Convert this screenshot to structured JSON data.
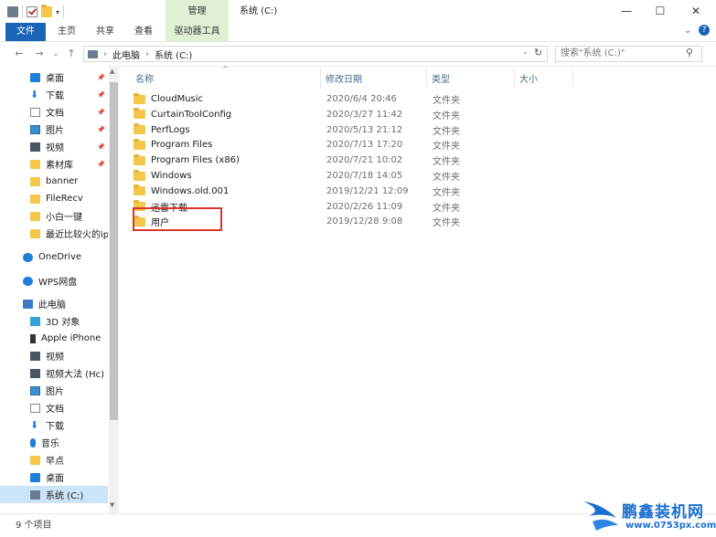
{
  "window": {
    "title": "系统 (C:)",
    "manage_tab": "管理",
    "min": "—",
    "max": "☐",
    "close": "✕"
  },
  "ribbon": {
    "tabs": [
      "文件",
      "主页",
      "共享",
      "查看",
      "驱动器工具"
    ]
  },
  "address": {
    "segments": [
      "此电脑",
      "系统 (C:)"
    ],
    "search_placeholder": "搜索\"系统 (C:)\""
  },
  "nav": {
    "items": [
      {
        "label": "桌面",
        "icon": "desktop-icon",
        "pinned": true
      },
      {
        "label": "下载",
        "icon": "download-icon",
        "pinned": true
      },
      {
        "label": "文档",
        "icon": "document-icon",
        "pinned": true
      },
      {
        "label": "图片",
        "icon": "picture-icon",
        "pinned": true
      },
      {
        "label": "视频",
        "icon": "video-icon",
        "pinned": true
      },
      {
        "label": "素材库",
        "icon": "folder-icon",
        "pinned": true
      },
      {
        "label": "banner",
        "icon": "folder-icon",
        "pinned": false
      },
      {
        "label": "FileRecv",
        "icon": "folder-icon",
        "pinned": false
      },
      {
        "label": "小白一键",
        "icon": "folder-icon",
        "pinned": false
      },
      {
        "label": "最近比较火的ipl",
        "icon": "folder-icon",
        "pinned": false
      },
      {
        "label": "OneDrive",
        "icon": "cloud-icon",
        "pinned": false
      },
      {
        "label": "WPS网盘",
        "icon": "cloud-icon",
        "pinned": false
      },
      {
        "label": "此电脑",
        "icon": "computer-icon",
        "pinned": false
      },
      {
        "label": "3D 对象",
        "icon": "cube-icon",
        "pinned": false
      },
      {
        "label": "Apple iPhone",
        "icon": "phone-icon",
        "pinned": false
      },
      {
        "label": "视频",
        "icon": "video-icon",
        "pinned": false
      },
      {
        "label": "视频大法 (Hc)",
        "icon": "video-icon",
        "pinned": false
      },
      {
        "label": "图片",
        "icon": "picture-icon",
        "pinned": false
      },
      {
        "label": "文档",
        "icon": "document-icon",
        "pinned": false
      },
      {
        "label": "下载",
        "icon": "download-icon",
        "pinned": false
      },
      {
        "label": "音乐",
        "icon": "music-icon",
        "pinned": false
      },
      {
        "label": "早点",
        "icon": "folder-icon",
        "pinned": false
      },
      {
        "label": "桌面",
        "icon": "desktop-icon",
        "pinned": false
      },
      {
        "label": "系统 (C:)",
        "icon": "drive-icon",
        "pinned": false,
        "selected": true
      }
    ]
  },
  "columns": {
    "name": "名称",
    "date": "修改日期",
    "type": "类型",
    "size": "大小"
  },
  "files": [
    {
      "name": "CloudMusic",
      "date": "2020/6/4 20:46",
      "type": "文件夹"
    },
    {
      "name": "CurtainToolConfig",
      "date": "2020/3/27 11:42",
      "type": "文件夹"
    },
    {
      "name": "PerfLogs",
      "date": "2020/5/13 21:12",
      "type": "文件夹"
    },
    {
      "name": "Program Files",
      "date": "2020/7/13 17:20",
      "type": "文件夹"
    },
    {
      "name": "Program Files (x86)",
      "date": "2020/7/21 10:02",
      "type": "文件夹"
    },
    {
      "name": "Windows",
      "date": "2020/7/18 14:05",
      "type": "文件夹"
    },
    {
      "name": "Windows.old.001",
      "date": "2019/12/21 12:09",
      "type": "文件夹"
    },
    {
      "name": "迅雷下载",
      "date": "2020/2/26 11:09",
      "type": "文件夹"
    },
    {
      "name": "用户",
      "date": "2019/12/28 9:08",
      "type": "文件夹"
    }
  ],
  "status": {
    "count": "9 个项目"
  },
  "watermark": {
    "brand": "鹏鑫装机网",
    "url": "www.0753px.com"
  },
  "colors": {
    "accent": "#1a64b8",
    "manage_green": "#dff0d4",
    "highlight": "#d9362b",
    "folder": "#f4c64a"
  }
}
